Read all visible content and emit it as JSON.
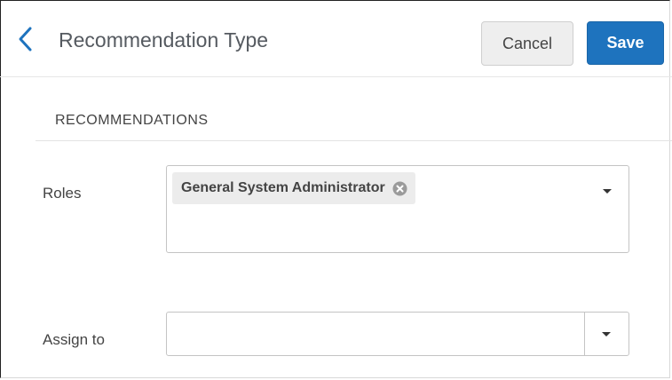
{
  "header": {
    "title": "Recommendation Type",
    "back_icon": "chevron-left-icon",
    "accent_color": "#1e73be",
    "cancel_label": "Cancel",
    "save_label": "Save"
  },
  "section": {
    "title": "RECOMMENDATIONS"
  },
  "fields": {
    "roles": {
      "label": "Roles",
      "selected": [
        "General System Administrator"
      ],
      "remove_icon": "clear-circle-icon",
      "dropdown_icon": "caret-down-icon"
    },
    "assign_to": {
      "label": "Assign to",
      "value": "",
      "dropdown_icon": "caret-down-icon"
    }
  }
}
